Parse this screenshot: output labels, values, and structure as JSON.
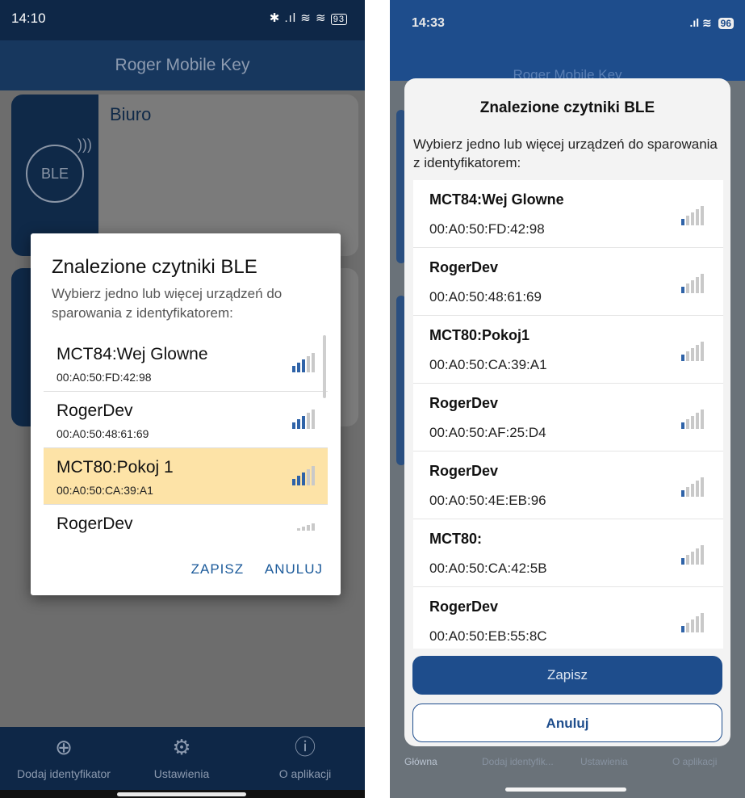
{
  "android": {
    "status": {
      "time": "14:10",
      "icons": "✱ .ıl ≋ ≋",
      "battery": "93"
    },
    "app_title": "Roger Mobile Key",
    "card": {
      "title": "Biuro",
      "badge": "BLE"
    },
    "dialog": {
      "title": "Znalezione czytniki BLE",
      "subtitle": "Wybierz jedno lub więcej urządzeń do sparowania z identyfikatorem:",
      "items": [
        {
          "name": "MCT84:Wej Glowne",
          "mac": "00:A0:50:FD:42:98",
          "signal": 3,
          "selected": false
        },
        {
          "name": "RogerDev",
          "mac": "00:A0:50:48:61:69",
          "signal": 3,
          "selected": false
        },
        {
          "name": "MCT80:Pokoj 1",
          "mac": "00:A0:50:CA:39:A1",
          "signal": 3,
          "selected": true
        },
        {
          "name": "RogerDev",
          "mac": "",
          "signal": 1,
          "selected": false
        }
      ],
      "save_label": "ZAPISZ",
      "cancel_label": "ANULUJ"
    },
    "nav": [
      {
        "icon": "add-circle-icon",
        "glyph": "⊕",
        "label": "Dodaj identyfikator"
      },
      {
        "icon": "gear-icon",
        "glyph": "⚙",
        "label": "Ustawienia"
      },
      {
        "icon": "info-icon",
        "glyph": "ⓘ",
        "label": "O aplikacji"
      }
    ]
  },
  "ios": {
    "status": {
      "time": "14:33",
      "icons": ".ıl ≋",
      "battery": "96"
    },
    "app_title": "Roger Mobile Key",
    "sheet": {
      "title": "Znalezione czytniki BLE",
      "subtitle": "Wybierz jedno lub więcej urządzeń do sparowania z identyfikatorem:",
      "items": [
        {
          "name": "MCT84:Wej Glowne",
          "mac": "00:A0:50:FD:42:98",
          "signal": 1
        },
        {
          "name": "RogerDev",
          "mac": "00:A0:50:48:61:69",
          "signal": 1
        },
        {
          "name": "MCT80:Pokoj1",
          "mac": "00:A0:50:CA:39:A1",
          "signal": 1
        },
        {
          "name": "RogerDev",
          "mac": "00:A0:50:AF:25:D4",
          "signal": 1
        },
        {
          "name": "RogerDev",
          "mac": "00:A0:50:4E:EB:96",
          "signal": 1
        },
        {
          "name": "MCT80:",
          "mac": "00:A0:50:CA:42:5B",
          "signal": 1
        },
        {
          "name": "RogerDev",
          "mac": "00:A0:50:EB:55:8C",
          "signal": 1
        }
      ],
      "save_label": "Zapisz",
      "cancel_label": "Anuluj"
    },
    "nav": [
      "Główna",
      "Dodaj identyfik...",
      "Ustawienia",
      "O aplikacji"
    ]
  },
  "colors": {
    "brand_navy": "#17375e",
    "ios_blue": "#1e4d8c",
    "selected_row": "#fde3a7",
    "signal_on": "#2f63a8"
  }
}
